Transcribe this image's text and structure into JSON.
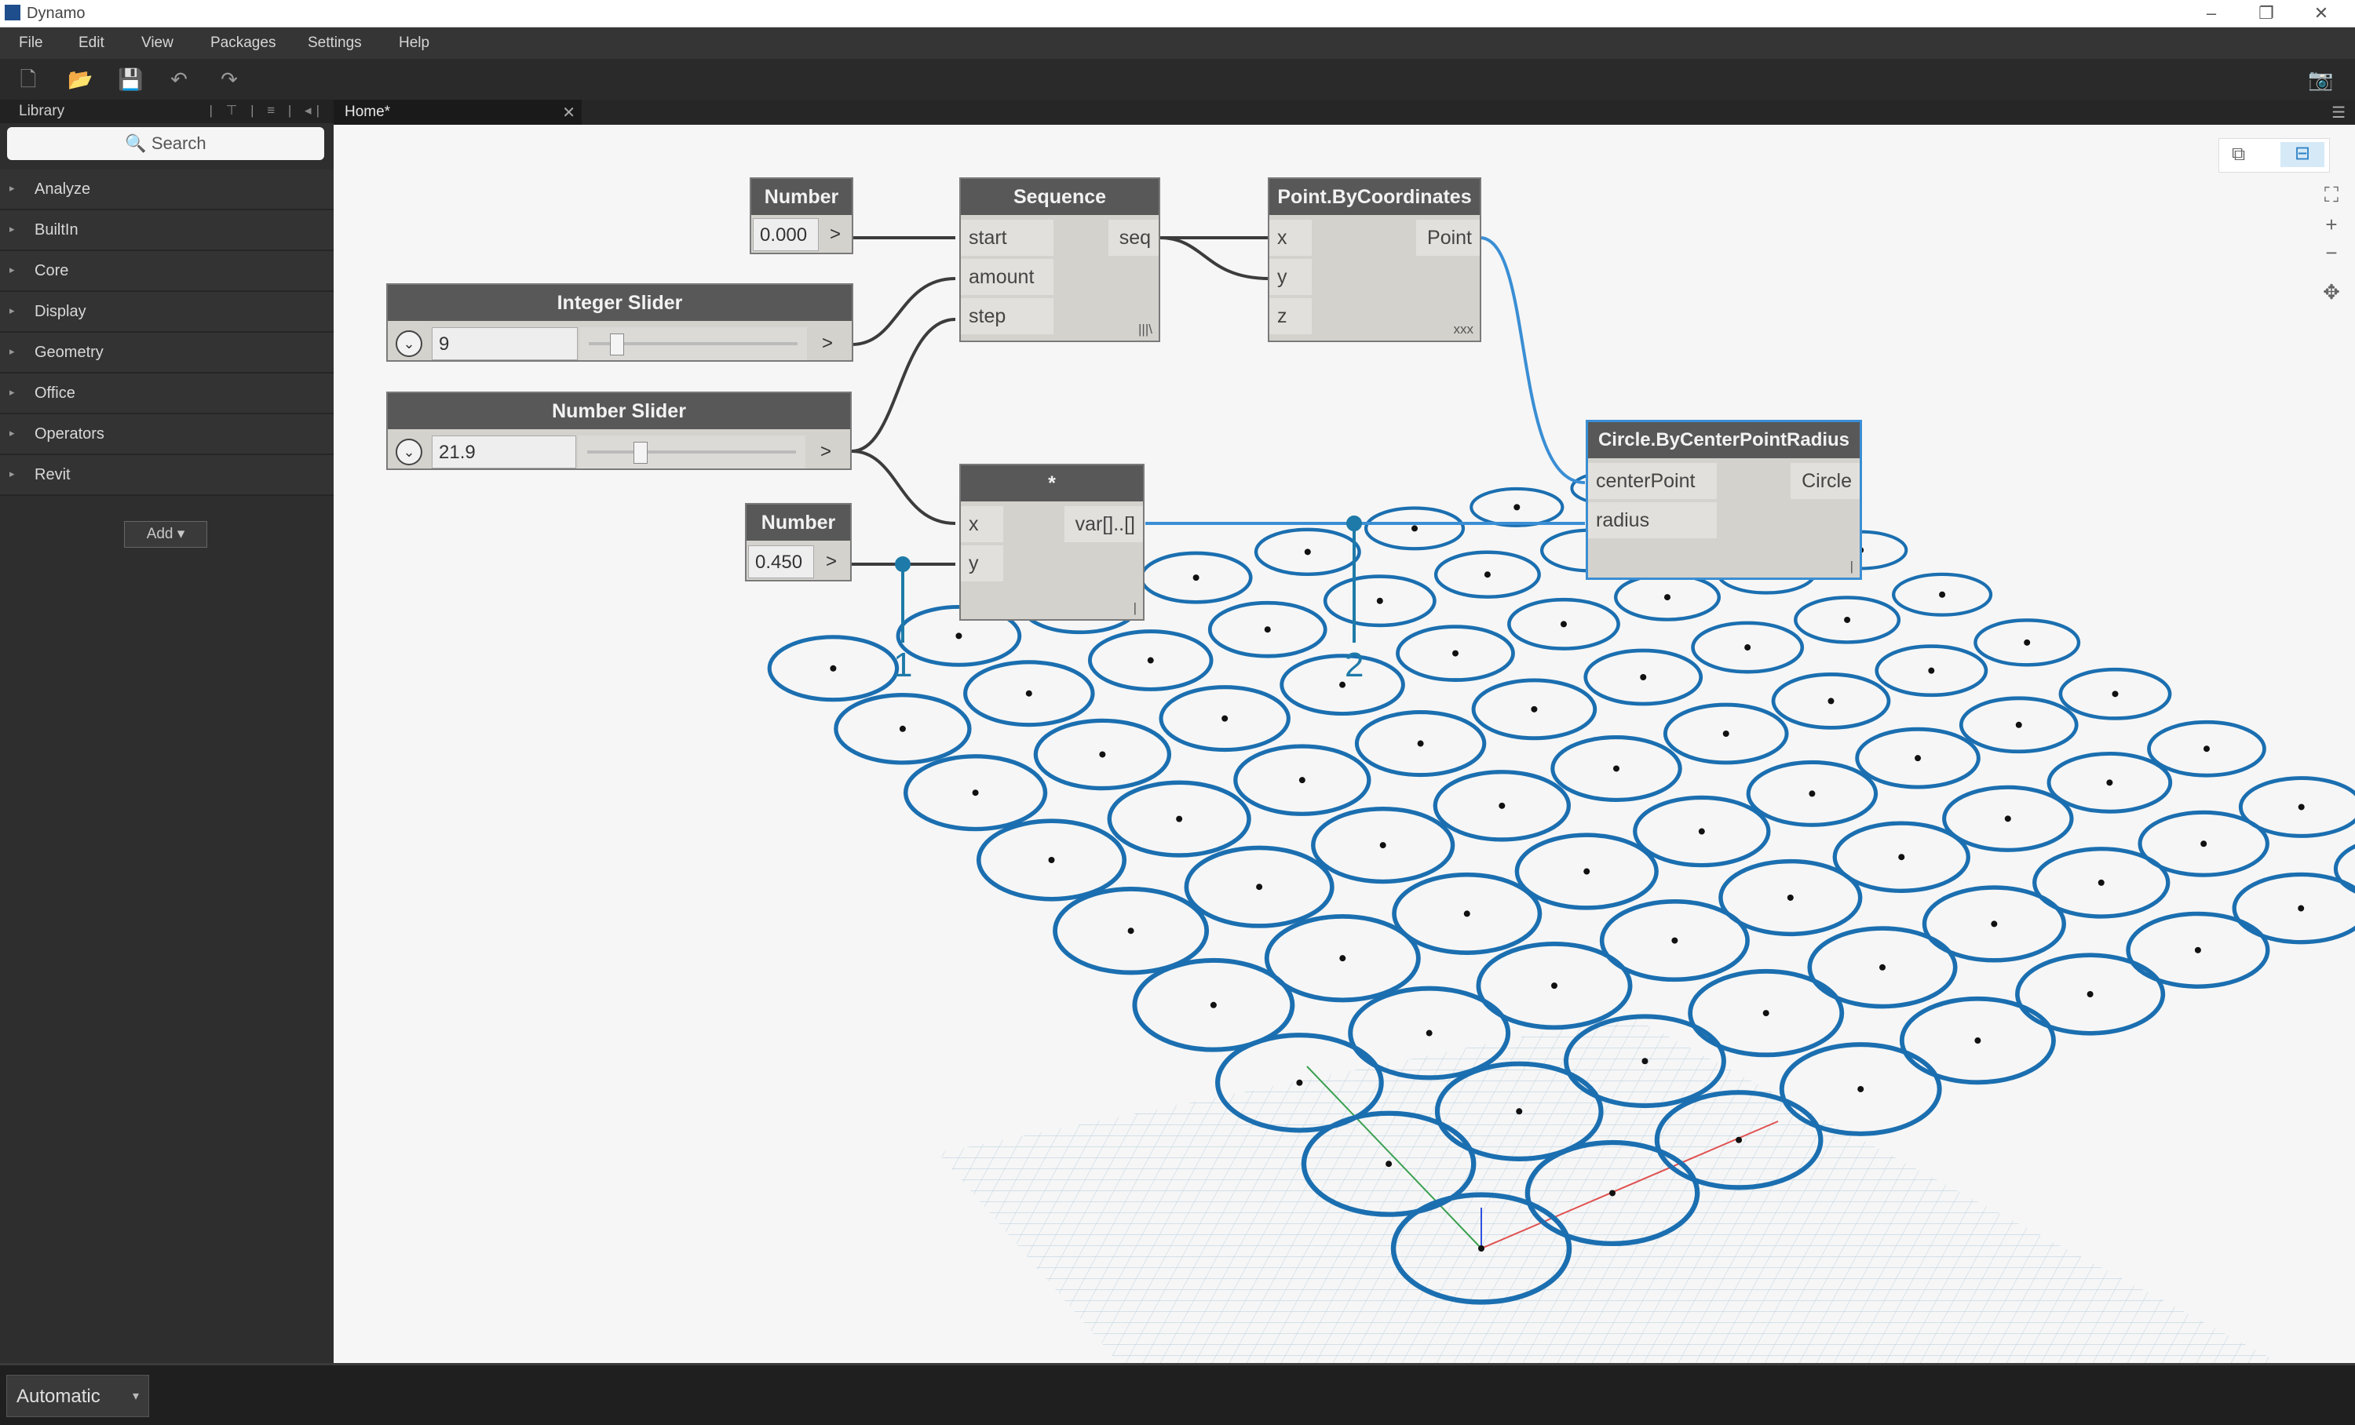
{
  "window": {
    "title": "Dynamo",
    "minimize": "–",
    "restore": "❐",
    "close": "✕"
  },
  "menu": [
    "File",
    "Edit",
    "View",
    "Packages",
    "Settings",
    "Help"
  ],
  "toolbar": {
    "new": "🗋",
    "open": "📂",
    "save": "💾",
    "undo": "↶",
    "redo": "↷",
    "screenshot": "📷"
  },
  "library": {
    "title": "Library",
    "tools": "| ⊤ | ≡ | ◂|",
    "search_placeholder": "Search",
    "categories": [
      "Analyze",
      "BuiltIn",
      "Core",
      "Display",
      "Geometry",
      "Office",
      "Operators",
      "Revit"
    ],
    "add_label": "Add  ▾"
  },
  "tab": {
    "label": "Home*",
    "close": "✕"
  },
  "nodes": {
    "number1": {
      "title": "Number",
      "value": "0.000",
      "arrow": ">"
    },
    "integer_slider": {
      "title": "Integer Slider",
      "value": "9",
      "arrow": ">",
      "slider_fraction": 0.1
    },
    "number_slider": {
      "title": "Number Slider",
      "value": "21.9",
      "arrow": ">",
      "slider_fraction": 0.22
    },
    "number2": {
      "title": "Number",
      "value": "0.450",
      "arrow": ">"
    },
    "sequence": {
      "title": "Sequence",
      "inputs": [
        "start",
        "amount",
        "step"
      ],
      "output": "seq",
      "lacing": "|||\\"
    },
    "point": {
      "title": "Point.ByCoordinates",
      "inputs": [
        "x",
        "y",
        "z"
      ],
      "output": "Point",
      "lacing": "xxx"
    },
    "multiply": {
      "title": "*",
      "inputs": [
        "x",
        "y"
      ],
      "output": "var[]..[]",
      "lacing": "|"
    },
    "circle": {
      "title": "Circle.ByCenterPointRadius",
      "inputs": [
        "centerPoint",
        "radius"
      ],
      "output": "Circle",
      "lacing": "|"
    }
  },
  "annotations": [
    "1",
    "2"
  ],
  "statusbar": {
    "run_mode": "Automatic",
    "caret": "▾"
  },
  "colors": {
    "wire_dark": "#3c3c3c",
    "wire_selected": "#3a8ed4",
    "annotation": "#1e7aa8",
    "circle": "#1b6fb0"
  }
}
